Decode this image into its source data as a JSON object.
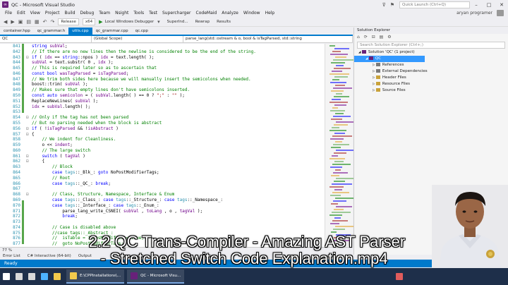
{
  "window": {
    "title": "QC - Microsoft Visual Studio",
    "quick_launch": "Quick Launch (Ctrl+Q)",
    "user": "aryan programer"
  },
  "menu": [
    "File",
    "Edit",
    "View",
    "Project",
    "Build",
    "Debug",
    "Team",
    "Nsight",
    "Tools",
    "Test",
    "Supercharger",
    "CodeMaid",
    "Analyze",
    "Window",
    "Help"
  ],
  "toolbar": {
    "config": "Release",
    "platform": "x64",
    "run_label": "Local Windows Debugger",
    "superindent": "SuperInd...",
    "rewrap": "Rewrap",
    "results": "Results"
  },
  "doc_tabs": [
    "container.hpp",
    "qc_grammar.h",
    "utils.cpp",
    "qc_grammar.cpp",
    "qc.cpp"
  ],
  "active_tab_index": 2,
  "nav": {
    "project": "QC",
    "scope": "(Global Scope)",
    "member": "parse_lang(std::ostream & o, bool & isTagParsed, std::string"
  },
  "code_lines": [
    {
      "n": "841",
      "t": "string subVal;"
    },
    {
      "n": "842",
      "t": "// If there are no new lines then the newline is considered to be the end of the string."
    },
    {
      "n": "843",
      "t": "if ( idx == string::npos ) idx = text.length( );"
    },
    {
      "n": "844",
      "t": "subVal = text.substr( 0 , idx );"
    },
    {
      "n": "845",
      "t": "// This is required later so as to ascertain that"
    },
    {
      "n": "846",
      "t": "const bool wasTagParsed = isTagParsed;"
    },
    {
      "n": "847",
      "t": "// We trim both sides here because we will manually insert the semicolons when needed."
    },
    {
      "n": "848",
      "t": "boost::trim( subVal );"
    },
    {
      "n": "849",
      "t": "// Makes sure that empty lines don't have semicolons inserted."
    },
    {
      "n": "850",
      "t": "const auto semicolon = ( subVal.length( ) == 0 ? \";\" : \"\" );"
    },
    {
      "n": "851",
      "t": "ReplaceNewLines( subVal );"
    },
    {
      "n": "852",
      "t": "idx = subVal.length( );"
    },
    {
      "n": "853",
      "t": ""
    },
    {
      "n": "854",
      "t": "// Only if the tag has not been parsed"
    },
    {
      "n": "855",
      "t": "// But no parsing needed when the block is abstract"
    },
    {
      "n": "856",
      "t": "if ( !isTagParsed && !isAbstract )"
    },
    {
      "n": "857",
      "t": "{"
    },
    {
      "n": "858",
      "t": "    // We indent for Cleanliness."
    },
    {
      "n": "859",
      "t": "    o << indent;"
    },
    {
      "n": "860",
      "t": "    // The large switch"
    },
    {
      "n": "861",
      "t": "    switch ( tagVal )"
    },
    {
      "n": "862",
      "t": "    {"
    },
    {
      "n": "863",
      "t": "        // Block"
    },
    {
      "n": "864",
      "t": "        case tags::_Blk_: goto NoPostModifierTags;"
    },
    {
      "n": "865",
      "t": "        // Root"
    },
    {
      "n": "866",
      "t": "        case tags::_QC_: break;"
    },
    {
      "n": "867",
      "t": ""
    },
    {
      "n": "868",
      "t": "        // Class, Structure, Namespace, Interface & Enum"
    },
    {
      "n": "869",
      "t": "        case tags::_Class_: case tags::_Structure_: case tags::_Namespace_:"
    },
    {
      "n": "870",
      "t": "        case tags::_Interface_: case tags::_Enum_:"
    },
    {
      "n": "871",
      "t": "            parse_lang_write_CSNEI( subVal , toLang , o , tagVal );"
    },
    {
      "n": "872",
      "t": "            break;"
    },
    {
      "n": "873",
      "t": ""
    },
    {
      "n": "874",
      "t": "        // Case is disabled above"
    },
    {
      "n": "875",
      "t": "        //case tags::_Abstract_:"
    },
    {
      "n": "876",
      "t": "        //  isTable = isAbsMoodifier = true;"
    },
    {
      "n": "877",
      "t": "        //  goto NoPostModifierTags;"
    }
  ],
  "zoom": "77 %",
  "solution_explorer": {
    "title": "Solution Explorer",
    "search_placeholder": "Search Solution Explorer (Ctrl+;)",
    "items": [
      {
        "label": "Solution 'QC' (1 project)",
        "level": 0
      },
      {
        "label": "QC",
        "level": 1
      },
      {
        "label": "References",
        "level": 2
      },
      {
        "label": "External Dependencies",
        "level": 2
      },
      {
        "label": "Header Files",
        "level": 2
      },
      {
        "label": "Resource Files",
        "level": 2
      },
      {
        "label": "Source Files",
        "level": 2
      }
    ]
  },
  "output_tabs": [
    "Error List",
    "C# Interactive (64-bit)",
    "Output"
  ],
  "status": "Ready",
  "taskbar": [
    {
      "label": "",
      "icon_color": "#ffffff",
      "kind": "start"
    },
    {
      "label": "",
      "icon_color": "#d9d9d9",
      "kind": "search"
    },
    {
      "label": "",
      "icon_color": "#d9d9d9",
      "kind": "taskview"
    },
    {
      "label": "",
      "icon_color": "#4db3ff",
      "kind": "edge"
    },
    {
      "label": "",
      "icon_color": "#f2c94c",
      "kind": "explorer"
    },
    {
      "label": "E:\\CPPInstallations\\...",
      "icon_color": "#f2c94c",
      "kind": "app"
    },
    {
      "label": "QC - Microsoft Visu...",
      "icon_color": "#68217a",
      "kind": "app"
    },
    {
      "label": "",
      "icon_color": "#e05c5c",
      "kind": "recorder"
    }
  ],
  "caption": {
    "line1": "2.2 QC Trans-Compiler - Amazing AST Parser",
    "line2": "- Stretched Switch Code Explanation.mp4"
  },
  "colors": {
    "accent": "#007acc",
    "comment": "#008000",
    "keyword": "#0000ff",
    "taskbar": "#1e2f4a"
  }
}
